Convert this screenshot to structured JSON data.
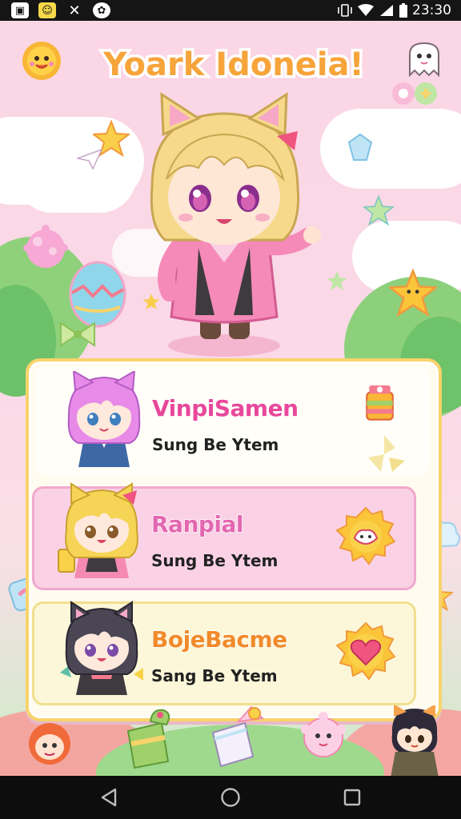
{
  "status_bar": {
    "time": "23:30",
    "icons": [
      "notification-image-icon",
      "notification-app-icon",
      "notification-game-icon",
      "notification-chat-icon",
      "vibrate-icon",
      "wifi-icon",
      "cell-signal-icon",
      "battery-icon"
    ]
  },
  "game": {
    "title": "Yoark Idoneia!",
    "rows": [
      {
        "name": "VinpiSamen",
        "subtitle": "Sung Be Ytem",
        "name_color": "#e8489a",
        "badge": "candy-icon"
      },
      {
        "name": "Ranpial",
        "subtitle": "Sung Be Ytem",
        "name_color": "#e367b0",
        "badge": "pet-bowl-icon"
      },
      {
        "name": "BojeBacme",
        "subtitle": "Sang Be Ytem",
        "name_color": "#f18a2a",
        "badge": "heart-icon"
      }
    ],
    "bottom_icons": [
      "red-creature-icon",
      "green-drink-icon",
      "gift-box-icon",
      "pink-puff-icon",
      "boy-avatar-icon"
    ]
  },
  "nav": {
    "buttons": [
      "back-button",
      "home-button",
      "recents-button"
    ]
  },
  "colors": {
    "background_pink": "#fbd6e5",
    "panel_border": "#f8d36b",
    "status_bar": "#151515",
    "nav_bar": "#0d0d0d"
  }
}
